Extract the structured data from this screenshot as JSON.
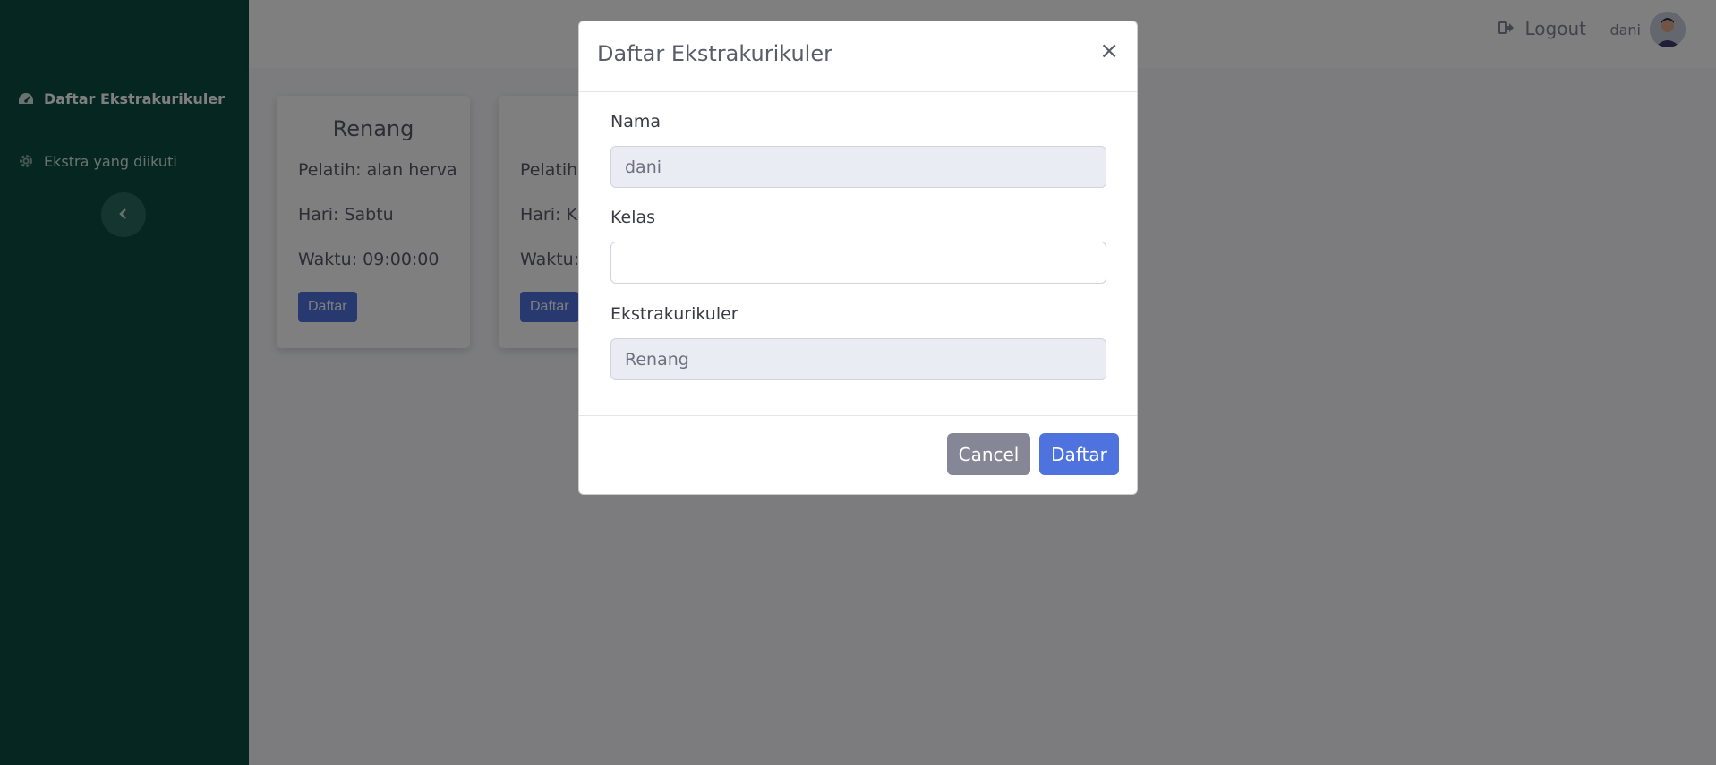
{
  "sidebar": {
    "items": [
      {
        "label": "Daftar Ekstrakurikuler",
        "icon": "tachometer-icon"
      },
      {
        "label": "Ekstra yang diikuti",
        "icon": "gear-icon"
      }
    ],
    "toggle_icon": "chevron-left-icon"
  },
  "topbar": {
    "logout_label": "Logout",
    "username": "dani"
  },
  "cards": [
    {
      "title": "Renang",
      "pelatih": "Pelatih: alan herva",
      "hari": "Hari: Sabtu",
      "waktu": "Waktu: 09:00:00",
      "button": "Daftar"
    },
    {
      "title": "",
      "pelatih": "Pelatih:",
      "hari": "Hari: Ka",
      "waktu": "Waktu:",
      "button": "Daftar"
    }
  ],
  "modal": {
    "title": "Daftar Ekstrakurikuler",
    "close_symbol": "×",
    "fields": [
      {
        "label": "Nama",
        "value": "dani",
        "readonly": true
      },
      {
        "label": "Kelas",
        "value": "",
        "readonly": false
      },
      {
        "label": "Ekstrakurikuler",
        "value": "Renang",
        "readonly": true
      }
    ],
    "cancel_label": "Cancel",
    "submit_label": "Daftar"
  },
  "colors": {
    "sidebar_bg": "#0a4d43",
    "primary": "#4e73df",
    "secondary": "#858796"
  }
}
